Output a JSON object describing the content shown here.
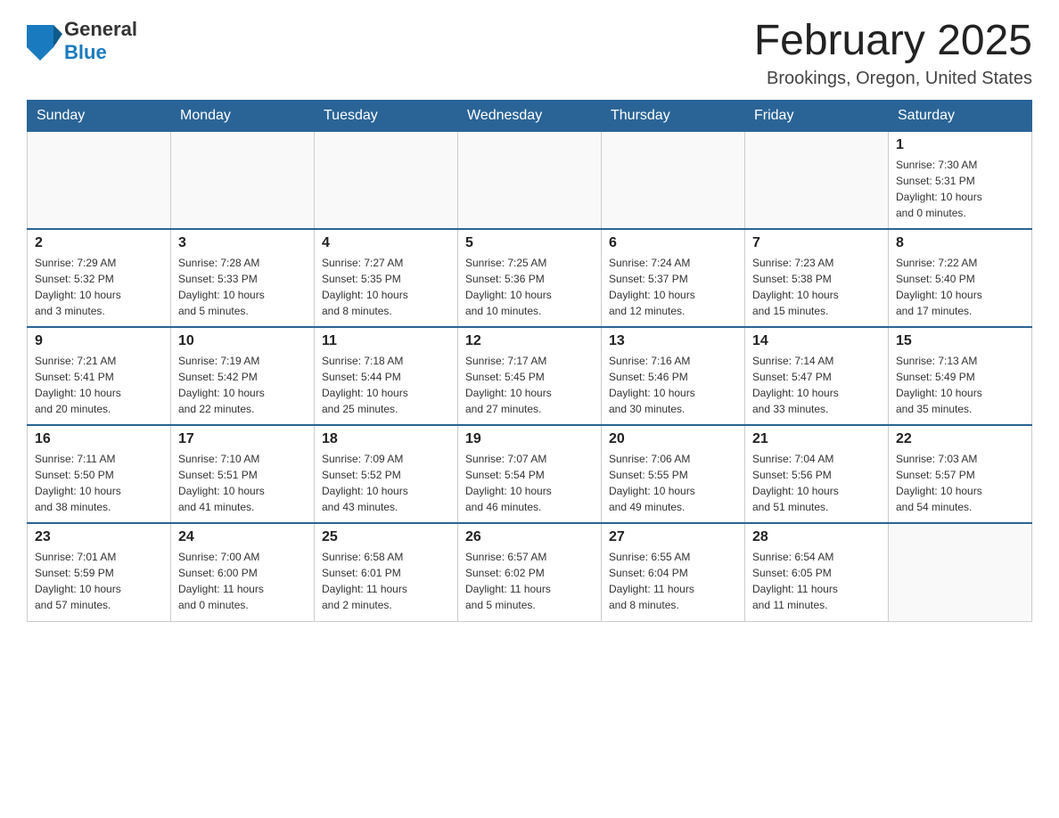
{
  "header": {
    "logo_general": "General",
    "logo_blue": "Blue",
    "month_title": "February 2025",
    "location": "Brookings, Oregon, United States"
  },
  "weekdays": [
    "Sunday",
    "Monday",
    "Tuesday",
    "Wednesday",
    "Thursday",
    "Friday",
    "Saturday"
  ],
  "weeks": [
    [
      {
        "day": "",
        "info": ""
      },
      {
        "day": "",
        "info": ""
      },
      {
        "day": "",
        "info": ""
      },
      {
        "day": "",
        "info": ""
      },
      {
        "day": "",
        "info": ""
      },
      {
        "day": "",
        "info": ""
      },
      {
        "day": "1",
        "info": "Sunrise: 7:30 AM\nSunset: 5:31 PM\nDaylight: 10 hours\nand 0 minutes."
      }
    ],
    [
      {
        "day": "2",
        "info": "Sunrise: 7:29 AM\nSunset: 5:32 PM\nDaylight: 10 hours\nand 3 minutes."
      },
      {
        "day": "3",
        "info": "Sunrise: 7:28 AM\nSunset: 5:33 PM\nDaylight: 10 hours\nand 5 minutes."
      },
      {
        "day": "4",
        "info": "Sunrise: 7:27 AM\nSunset: 5:35 PM\nDaylight: 10 hours\nand 8 minutes."
      },
      {
        "day": "5",
        "info": "Sunrise: 7:25 AM\nSunset: 5:36 PM\nDaylight: 10 hours\nand 10 minutes."
      },
      {
        "day": "6",
        "info": "Sunrise: 7:24 AM\nSunset: 5:37 PM\nDaylight: 10 hours\nand 12 minutes."
      },
      {
        "day": "7",
        "info": "Sunrise: 7:23 AM\nSunset: 5:38 PM\nDaylight: 10 hours\nand 15 minutes."
      },
      {
        "day": "8",
        "info": "Sunrise: 7:22 AM\nSunset: 5:40 PM\nDaylight: 10 hours\nand 17 minutes."
      }
    ],
    [
      {
        "day": "9",
        "info": "Sunrise: 7:21 AM\nSunset: 5:41 PM\nDaylight: 10 hours\nand 20 minutes."
      },
      {
        "day": "10",
        "info": "Sunrise: 7:19 AM\nSunset: 5:42 PM\nDaylight: 10 hours\nand 22 minutes."
      },
      {
        "day": "11",
        "info": "Sunrise: 7:18 AM\nSunset: 5:44 PM\nDaylight: 10 hours\nand 25 minutes."
      },
      {
        "day": "12",
        "info": "Sunrise: 7:17 AM\nSunset: 5:45 PM\nDaylight: 10 hours\nand 27 minutes."
      },
      {
        "day": "13",
        "info": "Sunrise: 7:16 AM\nSunset: 5:46 PM\nDaylight: 10 hours\nand 30 minutes."
      },
      {
        "day": "14",
        "info": "Sunrise: 7:14 AM\nSunset: 5:47 PM\nDaylight: 10 hours\nand 33 minutes."
      },
      {
        "day": "15",
        "info": "Sunrise: 7:13 AM\nSunset: 5:49 PM\nDaylight: 10 hours\nand 35 minutes."
      }
    ],
    [
      {
        "day": "16",
        "info": "Sunrise: 7:11 AM\nSunset: 5:50 PM\nDaylight: 10 hours\nand 38 minutes."
      },
      {
        "day": "17",
        "info": "Sunrise: 7:10 AM\nSunset: 5:51 PM\nDaylight: 10 hours\nand 41 minutes."
      },
      {
        "day": "18",
        "info": "Sunrise: 7:09 AM\nSunset: 5:52 PM\nDaylight: 10 hours\nand 43 minutes."
      },
      {
        "day": "19",
        "info": "Sunrise: 7:07 AM\nSunset: 5:54 PM\nDaylight: 10 hours\nand 46 minutes."
      },
      {
        "day": "20",
        "info": "Sunrise: 7:06 AM\nSunset: 5:55 PM\nDaylight: 10 hours\nand 49 minutes."
      },
      {
        "day": "21",
        "info": "Sunrise: 7:04 AM\nSunset: 5:56 PM\nDaylight: 10 hours\nand 51 minutes."
      },
      {
        "day": "22",
        "info": "Sunrise: 7:03 AM\nSunset: 5:57 PM\nDaylight: 10 hours\nand 54 minutes."
      }
    ],
    [
      {
        "day": "23",
        "info": "Sunrise: 7:01 AM\nSunset: 5:59 PM\nDaylight: 10 hours\nand 57 minutes."
      },
      {
        "day": "24",
        "info": "Sunrise: 7:00 AM\nSunset: 6:00 PM\nDaylight: 11 hours\nand 0 minutes."
      },
      {
        "day": "25",
        "info": "Sunrise: 6:58 AM\nSunset: 6:01 PM\nDaylight: 11 hours\nand 2 minutes."
      },
      {
        "day": "26",
        "info": "Sunrise: 6:57 AM\nSunset: 6:02 PM\nDaylight: 11 hours\nand 5 minutes."
      },
      {
        "day": "27",
        "info": "Sunrise: 6:55 AM\nSunset: 6:04 PM\nDaylight: 11 hours\nand 8 minutes."
      },
      {
        "day": "28",
        "info": "Sunrise: 6:54 AM\nSunset: 6:05 PM\nDaylight: 11 hours\nand 11 minutes."
      },
      {
        "day": "",
        "info": ""
      }
    ]
  ]
}
